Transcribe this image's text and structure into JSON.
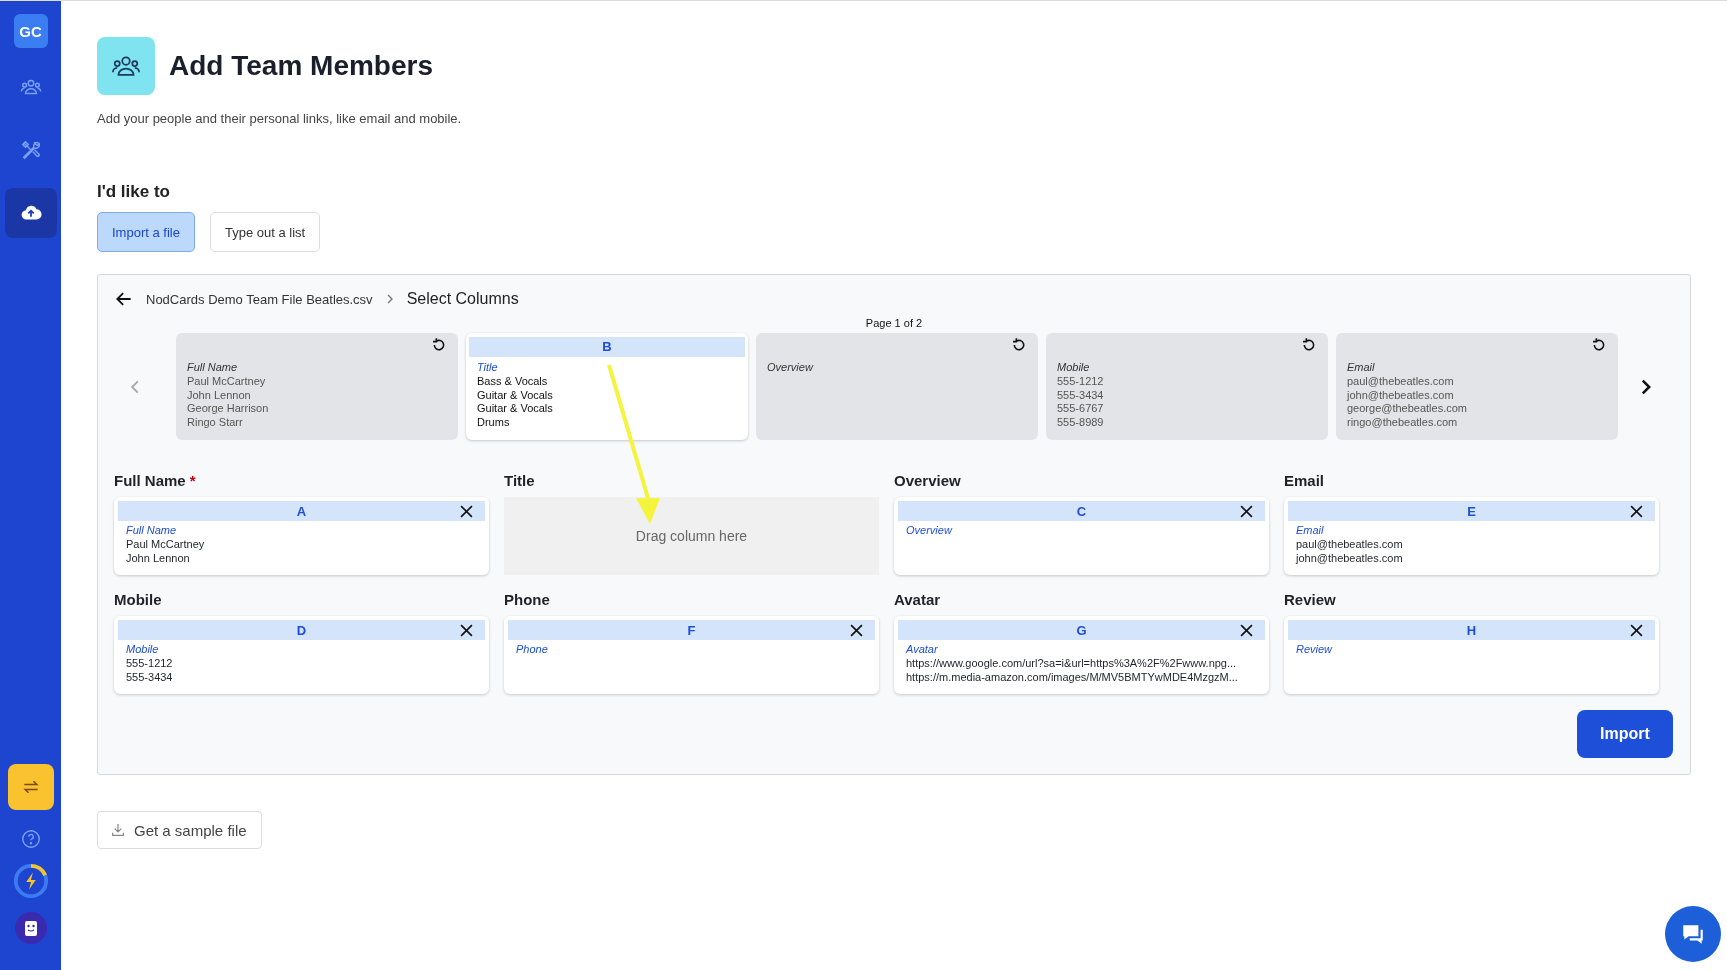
{
  "sidebar": {
    "avatar": "GC",
    "nav_items": [
      {
        "selected": false
      },
      {
        "selected": false
      },
      {
        "selected": true
      }
    ]
  },
  "header": {
    "title": "Add Team Members",
    "subtitle": "Add your people and their personal links, like email and mobile."
  },
  "mode": {
    "label": "I'd like to",
    "options": [
      {
        "label": "Import a file",
        "selected": true
      },
      {
        "label": "Type out a list",
        "selected": false
      }
    ]
  },
  "breadcrumb": {
    "file": "NodCards Demo Team File Beatles.csv",
    "step": "Select Columns"
  },
  "pager": "Page 1 of 2",
  "source_columns": [
    {
      "header": "Full Name",
      "values": [
        "Paul McCartney",
        "John Lennon",
        "George Harrison",
        "Ringo Starr"
      ],
      "selected": false
    },
    {
      "letter": "B",
      "header": "Title",
      "values": [
        "Bass & Vocals",
        "Guitar & Vocals",
        "Guitar & Vocals",
        "Drums"
      ],
      "selected": true
    },
    {
      "header": "Overview",
      "selected": false
    },
    {
      "header": "Mobile",
      "values": [
        "555-1212",
        "555-3434",
        "555-6767",
        "555-8989"
      ],
      "selected": false
    },
    {
      "header": "Email",
      "values": [
        "paul@thebeatles.com",
        "john@thebeatles.com",
        "george@thebeatles.com",
        "ringo@thebeatles.com"
      ],
      "selected": false
    }
  ],
  "fields": [
    {
      "label": "Full Name",
      "required": true,
      "kind": "mapped",
      "letter": "A",
      "header": "Full Name",
      "values": [
        "Paul McCartney",
        "John Lennon"
      ]
    },
    {
      "label": "Title",
      "required": false,
      "kind": "empty",
      "placeholder": "Drag column here"
    },
    {
      "label": "Overview",
      "required": false,
      "kind": "mapped",
      "letter": "C",
      "header": "Overview"
    },
    {
      "label": "Email",
      "required": false,
      "kind": "mapped",
      "letter": "E",
      "header": "Email",
      "values": [
        "paul@thebeatles.com",
        "john@thebeatles.com"
      ]
    },
    {
      "label": "Mobile",
      "required": false,
      "kind": "mapped",
      "letter": "D",
      "header": "Mobile",
      "values": [
        "555-1212",
        "555-3434"
      ]
    },
    {
      "label": "Phone",
      "required": false,
      "kind": "mapped",
      "letter": "F",
      "header": "Phone"
    },
    {
      "label": "Avatar",
      "required": false,
      "kind": "mapped",
      "letter": "G",
      "header": "Avatar",
      "values": [
        "https://www.google.com/url?sa=i&url=https%3A%2F%2Fwww.npg...",
        "https://m.media-amazon.com/images/M/MV5BMTYwMDE4MzgzM..."
      ]
    },
    {
      "label": "Review",
      "required": false,
      "kind": "mapped",
      "letter": "H",
      "header": "Review"
    }
  ],
  "required_mark": "*",
  "import_button": "Import",
  "sample_button": "Get a sample file"
}
